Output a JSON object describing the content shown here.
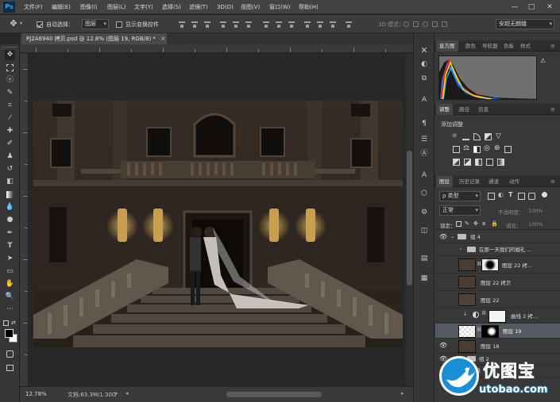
{
  "app": {
    "logo": "Ps"
  },
  "menu": [
    "文件(F)",
    "编辑(E)",
    "图像(I)",
    "图层(L)",
    "文字(Y)",
    "选择(S)",
    "滤镜(T)",
    "3D(D)",
    "视图(V)",
    "窗口(W)",
    "帮助(H)"
  ],
  "window_controls": {
    "minimize": "—",
    "maximize": "□",
    "close": "✕"
  },
  "options": {
    "auto_select_label": "自动选择：",
    "auto_select_checked": true,
    "auto_select_value": "图层",
    "show_transform_label": "显示变换控件",
    "show_transform_checked": false,
    "mode_3d_label": "3D 模式：",
    "workspace": "安超无朗缝"
  },
  "document": {
    "tab_title": "PJ2A6940 拷贝.psd @ 12.8% (图层 19, RGB/8) *",
    "close": "×",
    "zoom": "12.78%",
    "doc_size": "文档:63.3M/1.30G"
  },
  "histogram_panel": {
    "tabs": [
      "直方图",
      "颜色",
      "导航器",
      "色板",
      "样式"
    ],
    "active_tab": 0,
    "warning_icon": "⚠"
  },
  "adjustments_panel": {
    "tabs": [
      "调整",
      "路径",
      "信息"
    ],
    "active_tab": 0,
    "title": "添加调整"
  },
  "layers_panel": {
    "tabs": [
      "图层",
      "历史记录",
      "通道",
      "动作"
    ],
    "active_tab": 0,
    "filter_kind": "ρ 类型",
    "blend_mode": "正常",
    "opacity_label": "不透明度：",
    "opacity_value": "100%",
    "lock_label": "锁定：",
    "fill_label": "填充：",
    "fill_value": "100%",
    "layers": [
      {
        "name": "组 4",
        "type": "group",
        "visible": true,
        "expanded": true,
        "indent": 0
      },
      {
        "name": "在那一天我们的婚礼 ...",
        "type": "group",
        "visible": false,
        "expanded": false,
        "indent": 1
      },
      {
        "name": "图层 22 拷...",
        "type": "image_mask",
        "visible": false,
        "indent": 1
      },
      {
        "name": "图层 22 拷贝",
        "type": "image",
        "visible": false,
        "indent": 1
      },
      {
        "name": "图层 22",
        "type": "image",
        "visible": false,
        "indent": 1
      },
      {
        "name": "曲线 2 拷...",
        "type": "adjustment",
        "visible": false,
        "indent": 1,
        "clipped": true
      },
      {
        "name": "图层 19",
        "type": "transparent_mask",
        "visible": false,
        "indent": 1,
        "selected": true
      },
      {
        "name": "图层 18",
        "type": "image",
        "visible": true,
        "indent": 1
      },
      {
        "name": "组 2",
        "type": "group",
        "visible": true,
        "expanded": false,
        "indent": 1
      },
      {
        "name": "背景",
        "type": "image",
        "visible": true,
        "indent": 0
      }
    ]
  },
  "watermark": {
    "text": "优图宝",
    "url": "utobao.com"
  },
  "colors": {
    "accent_blue": "#31a8ff",
    "selected_row": "#555a60",
    "panel_bg": "#383838",
    "watermark_blue": "#1b8fd6"
  }
}
